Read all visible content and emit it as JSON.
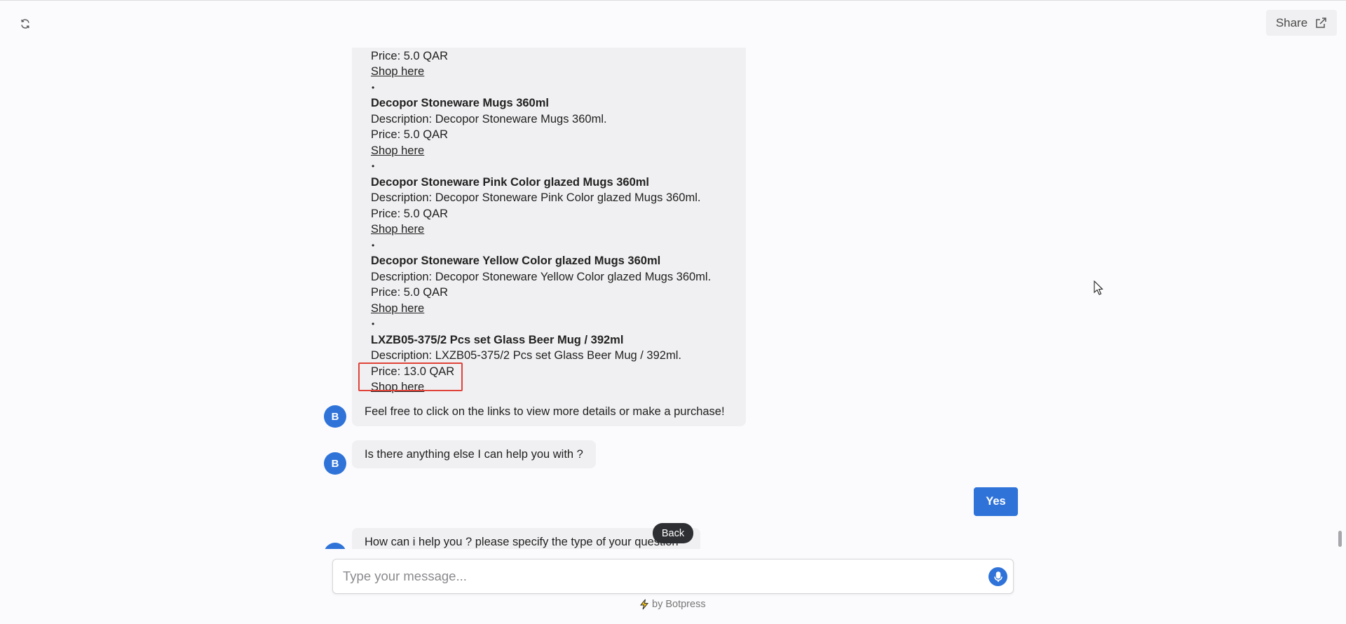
{
  "header": {
    "refresh_icon": "refresh-icon",
    "share_label": "Share",
    "share_icon": "external-link-icon"
  },
  "messages": {
    "product_list": [
      {
        "type": "desc",
        "text": "Description: Decopor Stoneware Mugs 360ml."
      },
      {
        "type": "price",
        "text": "Price: 5.0 QAR"
      },
      {
        "type": "link",
        "text": "Shop here"
      },
      {
        "type": "bullet",
        "text": "•"
      },
      {
        "type": "name",
        "text": "Decopor Stoneware Mugs 360ml"
      },
      {
        "type": "desc",
        "text": "Description: Decopor Stoneware Mugs 360ml."
      },
      {
        "type": "price",
        "text": "Price: 5.0 QAR"
      },
      {
        "type": "link",
        "text": "Shop here"
      },
      {
        "type": "bullet",
        "text": "•"
      },
      {
        "type": "name",
        "text": "Decopor Stoneware Pink Color glazed Mugs 360ml"
      },
      {
        "type": "desc",
        "text": "Description: Decopor Stoneware Pink Color glazed Mugs 360ml."
      },
      {
        "type": "price",
        "text": "Price: 5.0 QAR"
      },
      {
        "type": "link",
        "text": "Shop here"
      },
      {
        "type": "bullet",
        "text": "•"
      },
      {
        "type": "name",
        "text": "Decopor Stoneware Yellow Color glazed Mugs 360ml"
      },
      {
        "type": "desc",
        "text": "Description: Decopor Stoneware Yellow Color glazed Mugs 360ml."
      },
      {
        "type": "price",
        "text": "Price: 5.0 QAR"
      },
      {
        "type": "link",
        "text": "Shop here"
      },
      {
        "type": "bullet",
        "text": "•"
      },
      {
        "type": "name",
        "text": "LXZB05-375/2 Pcs set Glass Beer Mug / 392ml"
      },
      {
        "type": "desc",
        "text": "Description: LXZB05-375/2 Pcs set Glass Beer Mug / 392ml."
      },
      {
        "type": "price",
        "text": "Price: 13.0 QAR"
      },
      {
        "type": "link",
        "text": "Shop here"
      }
    ],
    "closing_text": "Feel free to click on the links to view more details or make a purchase!",
    "help_question": "Is there anything else I can help you with ?",
    "user_reply": "Yes",
    "specify_question": "How can i help you ? please specify the type of your question",
    "avatar_letter": "B"
  },
  "back_tooltip": "Back",
  "composer": {
    "placeholder": "Type your message...",
    "mic_icon": "microphone-icon"
  },
  "footer": {
    "powered_by": "by Botpress",
    "bolt_icon": "lightning-icon"
  },
  "colors": {
    "accent": "#2f73d9",
    "bubble_bg": "#f0f0f2",
    "highlight": "#e0433a"
  }
}
